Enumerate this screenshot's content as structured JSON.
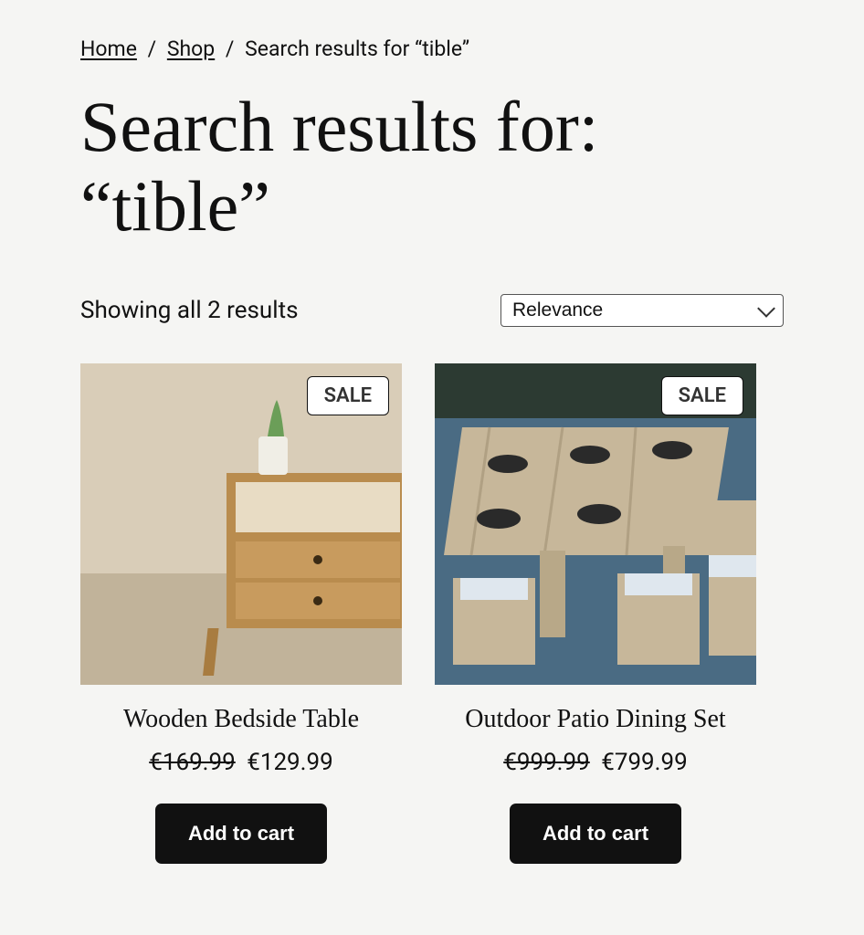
{
  "breadcrumb": {
    "home": "Home",
    "shop": "Shop",
    "current": "Search results for “tible”",
    "sep": "/"
  },
  "page_title": "Search results for: “tible”",
  "result_count": "Showing all 2 results",
  "sort": {
    "selected": "Relevance"
  },
  "sale_label": "SALE",
  "add_to_cart_label": "Add to cart",
  "products": [
    {
      "name": "Wooden Bedside Table",
      "old_price": "€169.99",
      "new_price": "€129.99",
      "on_sale": true
    },
    {
      "name": "Outdoor Patio Dining Set",
      "old_price": "€999.99",
      "new_price": "€799.99",
      "on_sale": true
    }
  ]
}
